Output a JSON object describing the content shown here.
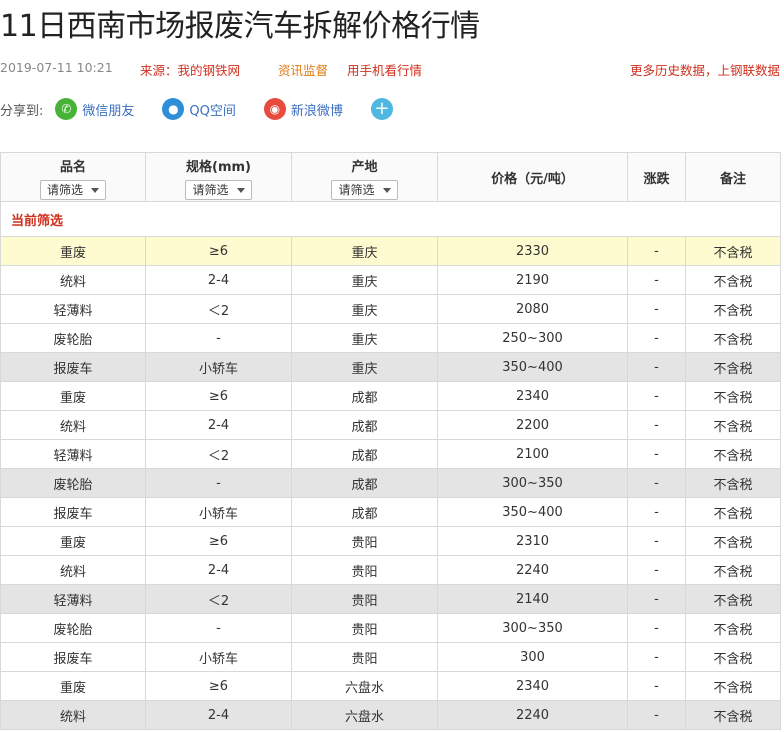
{
  "title": "11日西南市场报废汽车拆解价格行情",
  "meta": {
    "datetime": "2019-07-11 10:21",
    "source": "来源：我的钢铁网",
    "supervise": "资讯监督",
    "mobile": "用手机看行情",
    "history": "更多历史数据，上钢联数据"
  },
  "share": {
    "label": "分享到:",
    "wechat": "微信朋友",
    "qq": "QQ空间",
    "weibo": "新浪微博",
    "more_symbol": "+"
  },
  "table": {
    "headers": {
      "name": "品名",
      "spec": "规格(mm)",
      "origin": "产地",
      "price": "价格（元/吨）",
      "change": "涨跌",
      "note": "备注"
    },
    "filter_placeholder": "请筛选",
    "current_filter": "当前筛选",
    "rows": [
      [
        "重废",
        "≥6",
        "重庆",
        "2330",
        "-",
        "不含税"
      ],
      [
        "统料",
        "2-4",
        "重庆",
        "2190",
        "-",
        "不含税"
      ],
      [
        "轻薄料",
        "＜2",
        "重庆",
        "2080",
        "-",
        "不含税"
      ],
      [
        "废轮胎",
        "-",
        "重庆",
        "250~300",
        "-",
        "不含税"
      ],
      [
        "报废车",
        "小轿车",
        "重庆",
        "350~400",
        "-",
        "不含税"
      ],
      [
        "重废",
        "≥6",
        "成都",
        "2340",
        "-",
        "不含税"
      ],
      [
        "统料",
        "2-4",
        "成都",
        "2200",
        "-",
        "不含税"
      ],
      [
        "轻薄料",
        "＜2",
        "成都",
        "2100",
        "-",
        "不含税"
      ],
      [
        "废轮胎",
        "-",
        "成都",
        "300~350",
        "-",
        "不含税"
      ],
      [
        "报废车",
        "小轿车",
        "成都",
        "350~400",
        "-",
        "不含税"
      ],
      [
        "重废",
        "≥6",
        "贵阳",
        "2310",
        "-",
        "不含税"
      ],
      [
        "统料",
        "2-4",
        "贵阳",
        "2240",
        "-",
        "不含税"
      ],
      [
        "轻薄料",
        "＜2",
        "贵阳",
        "2140",
        "-",
        "不含税"
      ],
      [
        "废轮胎",
        "-",
        "贵阳",
        "300~350",
        "-",
        "不含税"
      ],
      [
        "报废车",
        "小轿车",
        "贵阳",
        "300",
        "-",
        "不含税"
      ],
      [
        "重废",
        "≥6",
        "六盘水",
        "2340",
        "-",
        "不含税"
      ],
      [
        "统料",
        "2-4",
        "六盘水",
        "2240",
        "-",
        "不含税"
      ]
    ]
  }
}
